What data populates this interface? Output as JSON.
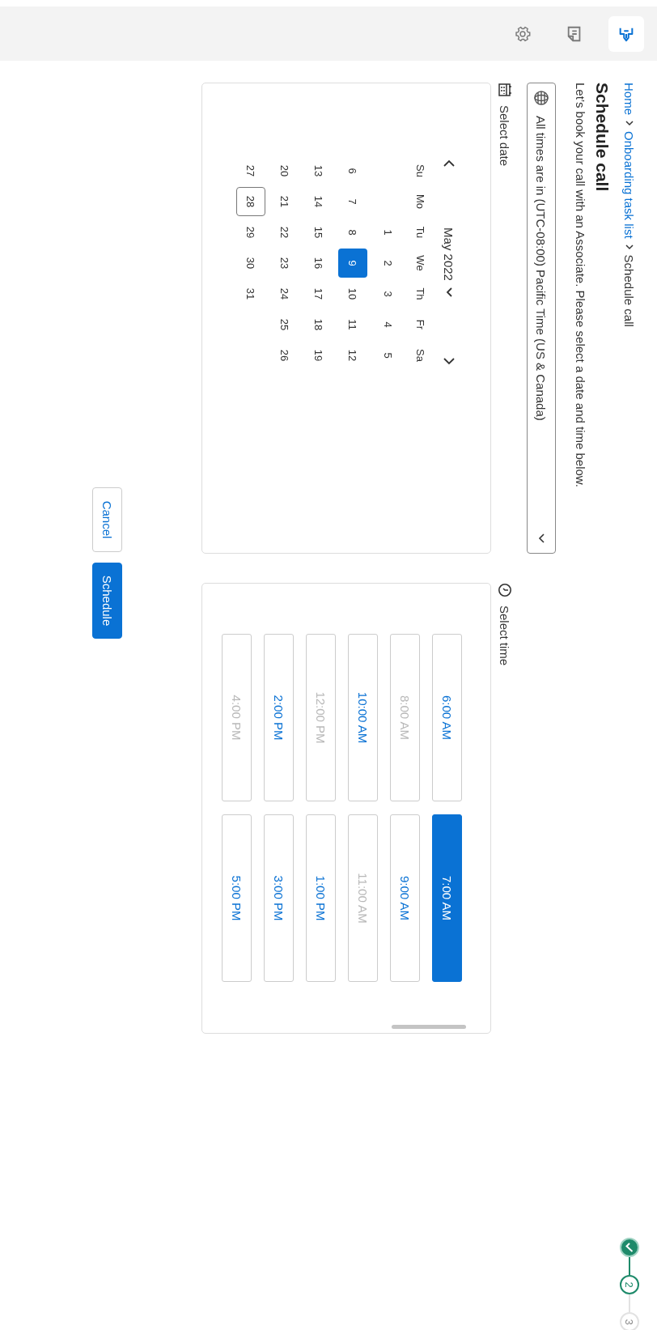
{
  "sidebar": {
    "items": [
      {
        "kind": "enter",
        "selected": true
      },
      {
        "kind": "note",
        "selected": false
      },
      {
        "kind": "settings",
        "selected": false
      }
    ]
  },
  "breadcrumb": [
    {
      "label": "Home",
      "link": true
    },
    {
      "label": "Onboarding task list",
      "link": true
    },
    {
      "label": "Schedule call",
      "link": false
    }
  ],
  "stepper": [
    {
      "kind": "done"
    },
    {
      "label": "2",
      "kind": "current"
    },
    {
      "label": "3",
      "kind": "upcoming"
    }
  ],
  "title": "Schedule call",
  "subtitle": "Let’s book your call with an Associate. Please select a date and time below.",
  "timezone": {
    "value": "All times are in (UTC-08:00) Pacific Time (US & Canada)"
  },
  "date_section": {
    "label": "Select date",
    "month": "May 2022",
    "weekdays": [
      "Su",
      "Mo",
      "Tu",
      "We",
      "Th",
      "Fr",
      "Sa"
    ],
    "weeks": [
      [
        {
          "d": "1",
          "selected": false,
          "today": false
        },
        {
          "d": "2",
          "selected": false,
          "today": false
        },
        {
          "d": "3",
          "selected": false,
          "today": false
        },
        {
          "d": "4",
          "selected": false,
          "today": false
        },
        {
          "d": "5",
          "selected": false,
          "today": false
        }
      ],
      [
        {
          "d": "6",
          "selected": false,
          "today": false
        },
        {
          "d": "7",
          "selected": false,
          "today": false
        },
        {
          "d": "8",
          "selected": false,
          "today": false
        },
        {
          "d": "9",
          "selected": true,
          "today": false
        },
        {
          "d": "10",
          "selected": false,
          "today": false
        },
        {
          "d": "11",
          "selected": false,
          "today": false
        },
        {
          "d": "12",
          "selected": false,
          "today": false
        }
      ],
      [
        {
          "d": "13",
          "selected": false,
          "today": false
        },
        {
          "d": "14",
          "selected": false,
          "today": false
        },
        {
          "d": "15",
          "selected": false,
          "today": false
        },
        {
          "d": "16",
          "selected": false,
          "today": false
        },
        {
          "d": "17",
          "selected": false,
          "today": false
        },
        {
          "d": "18",
          "selected": false,
          "today": false
        },
        {
          "d": "19",
          "selected": false,
          "today": false
        }
      ],
      [
        {
          "d": "20",
          "selected": false,
          "today": false
        },
        {
          "d": "21",
          "selected": false,
          "today": false
        },
        {
          "d": "22",
          "selected": false,
          "today": false
        },
        {
          "d": "23",
          "selected": false,
          "today": false
        },
        {
          "d": "24",
          "selected": false,
          "today": false
        },
        {
          "d": "25",
          "selected": false,
          "today": false
        },
        {
          "d": "26",
          "selected": false,
          "today": false
        }
      ],
      [
        {
          "d": "27",
          "selected": false,
          "today": false
        },
        {
          "d": "28",
          "selected": false,
          "today": true
        },
        {
          "d": "29",
          "selected": false,
          "today": false
        },
        {
          "d": "30",
          "selected": false,
          "today": false
        },
        {
          "d": "31",
          "selected": false,
          "today": false
        }
      ]
    ]
  },
  "time_section": {
    "label": "Select time",
    "slots": [
      {
        "time": "6:00 AM",
        "selected": false,
        "disabled": false
      },
      {
        "time": "7:00 AM",
        "selected": true,
        "disabled": false
      },
      {
        "time": "8:00 AM",
        "selected": false,
        "disabled": true
      },
      {
        "time": "9:00 AM",
        "selected": false,
        "disabled": false
      },
      {
        "time": "10:00 AM",
        "selected": false,
        "disabled": false
      },
      {
        "time": "11:00 AM",
        "selected": false,
        "disabled": true
      },
      {
        "time": "12:00 PM",
        "selected": false,
        "disabled": true
      },
      {
        "time": "1:00 PM",
        "selected": false,
        "disabled": false
      },
      {
        "time": "2:00 PM",
        "selected": false,
        "disabled": false
      },
      {
        "time": "3:00 PM",
        "selected": false,
        "disabled": false
      },
      {
        "time": "4:00 PM",
        "selected": false,
        "disabled": true
      },
      {
        "time": "5:00 PM",
        "selected": false,
        "disabled": false
      }
    ]
  },
  "buttons": [
    {
      "label": "Cancel",
      "kind": "secondary"
    },
    {
      "label": "Schedule",
      "kind": "primary"
    }
  ]
}
